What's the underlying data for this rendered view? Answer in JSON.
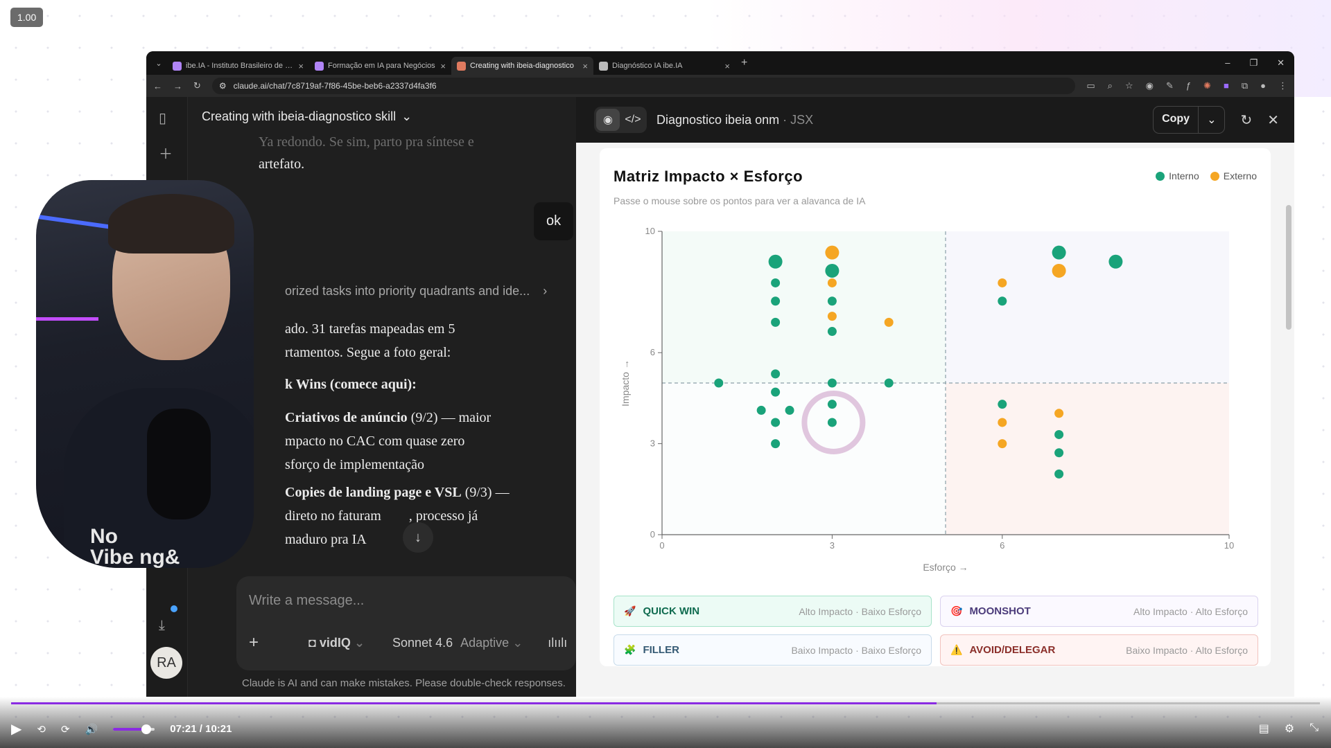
{
  "player": {
    "speed": "1.00",
    "time": "07:21 / 10:21",
    "progress": 0.707,
    "volume": 0.8
  },
  "browser": {
    "tabs": [
      {
        "title": "ibe.IA - Instituto Brasileiro de E...",
        "color": "#b084f5",
        "active": false
      },
      {
        "title": "Formação em IA para Negócios",
        "color": "#b084f5",
        "active": false
      },
      {
        "title": "Creating with ibeia-diagnostico",
        "color": "#e07a5f",
        "active": true
      },
      {
        "title": "Diagnóstico IA ibe.IA",
        "color": "#bbbbbb",
        "active": false
      }
    ],
    "url": "claude.ai/chat/7c8719af-7f86-45be-beb6-a2337d4fa3f6"
  },
  "chat": {
    "title": "Creating with ibeia-diagnostico skill",
    "faded_line": "Ya redondo. Se sim, parto pra síntese e",
    "line_artefato": "artefato.",
    "user_message": "ok",
    "tool_summary": "orized tasks into priority quadrants and ide...",
    "p1a": "ado. 31 tarefas mapeadas em 5",
    "p1b": "rtamentos. Segue a foto geral:",
    "heading": "k Wins (comece aqui):",
    "li1_bold": "Criativos de anúncio",
    "li1_meta": " (9/2) — maior",
    "li1_b": "mpacto no CAC com quase zero",
    "li1_c": "sforço de implementação",
    "li2_bold": "Copies de landing page e VSL",
    "li2_meta": " (9/3) —",
    "li2_b": "direto no faturam",
    "li2_b2": ", processo já",
    "li2_c": "maduro pra IA",
    "composer_placeholder": "Write a message...",
    "tool_name": "vidIQ",
    "model": "Sonnet 4.6",
    "mode": "Adaptive",
    "disclaimer": "Claude is AI and can make mistakes. Please double-check responses.",
    "avatar": "RA"
  },
  "artifact": {
    "title": "Diagnostico ibeia onm",
    "type": "· JSX",
    "copy": "Copy",
    "matrix_title": "Matriz Impacto × Esforço",
    "matrix_sub": "Passe o mouse sobre os pontos para ver a alavanca de IA",
    "legend_interno": "Interno",
    "legend_externo": "Externo",
    "quadrants": [
      {
        "icon": "🚀",
        "name": "QUICK WIN",
        "desc": "Alto Impacto · Baixo Esforço",
        "cls": "q-quick"
      },
      {
        "icon": "🎯",
        "name": "MOONSHOT",
        "desc": "Alto Impacto · Alto Esforço",
        "cls": "q-moon"
      },
      {
        "icon": "🧩",
        "name": "FILLER",
        "desc": "Baixo Impacto · Baixo Esforço",
        "cls": "q-filler"
      },
      {
        "icon": "⚠️",
        "name": "AVOID/DELEGAR",
        "desc": "Baixo Impacto · Alto Esforço",
        "cls": "q-avoid"
      }
    ]
  },
  "webcam": {
    "text1": "No",
    "text2": "Vibe   ng&"
  },
  "chart_data": {
    "type": "scatter",
    "xlabel": "Esforço →",
    "ylabel": "Impacto →",
    "xlim": [
      0,
      10
    ],
    "ylim": [
      0,
      10
    ],
    "xticks": [
      0,
      3,
      6,
      10
    ],
    "yticks": [
      0,
      3,
      6,
      10
    ],
    "thresholds": {
      "x": 5,
      "y": 5
    },
    "colors": {
      "Interno": "#1aa37a",
      "Externo": "#f5a623"
    },
    "points": [
      {
        "x": 2,
        "y": 9,
        "series": "Interno",
        "size": "large"
      },
      {
        "x": 2,
        "y": 8.3,
        "series": "Interno"
      },
      {
        "x": 2,
        "y": 7.7,
        "series": "Interno"
      },
      {
        "x": 2,
        "y": 7,
        "series": "Interno"
      },
      {
        "x": 3,
        "y": 9.3,
        "series": "Externo",
        "size": "large"
      },
      {
        "x": 3,
        "y": 8.7,
        "series": "Interno",
        "size": "large"
      },
      {
        "x": 3,
        "y": 8.3,
        "series": "Externo"
      },
      {
        "x": 3,
        "y": 7.7,
        "series": "Interno"
      },
      {
        "x": 3,
        "y": 7.2,
        "series": "Externo"
      },
      {
        "x": 3,
        "y": 6.7,
        "series": "Interno"
      },
      {
        "x": 4,
        "y": 7,
        "series": "Externo"
      },
      {
        "x": 1,
        "y": 5,
        "series": "Interno"
      },
      {
        "x": 2,
        "y": 5.3,
        "series": "Interno"
      },
      {
        "x": 3,
        "y": 5,
        "series": "Interno"
      },
      {
        "x": 4,
        "y": 5,
        "series": "Interno"
      },
      {
        "x": 2,
        "y": 4.7,
        "series": "Interno"
      },
      {
        "x": 1.75,
        "y": 4.1,
        "series": "Interno"
      },
      {
        "x": 2.25,
        "y": 4.1,
        "series": "Interno"
      },
      {
        "x": 2,
        "y": 3.7,
        "series": "Interno"
      },
      {
        "x": 2,
        "y": 3,
        "series": "Interno"
      },
      {
        "x": 3,
        "y": 4.3,
        "series": "Interno"
      },
      {
        "x": 3,
        "y": 3.7,
        "series": "Interno",
        "highlight": true
      },
      {
        "x": 6,
        "y": 8.3,
        "series": "Externo"
      },
      {
        "x": 6,
        "y": 7.7,
        "series": "Interno"
      },
      {
        "x": 7,
        "y": 9.3,
        "series": "Interno",
        "size": "large"
      },
      {
        "x": 7,
        "y": 8.7,
        "series": "Externo",
        "size": "large"
      },
      {
        "x": 8,
        "y": 9,
        "series": "Interno",
        "size": "large"
      },
      {
        "x": 6,
        "y": 4.3,
        "series": "Interno"
      },
      {
        "x": 6,
        "y": 3.7,
        "series": "Externo"
      },
      {
        "x": 6,
        "y": 3,
        "series": "Externo"
      },
      {
        "x": 7,
        "y": 4,
        "series": "Externo"
      },
      {
        "x": 7,
        "y": 3.3,
        "series": "Interno"
      },
      {
        "x": 7,
        "y": 2.7,
        "series": "Interno"
      },
      {
        "x": 7,
        "y": 2,
        "series": "Interno"
      }
    ]
  }
}
